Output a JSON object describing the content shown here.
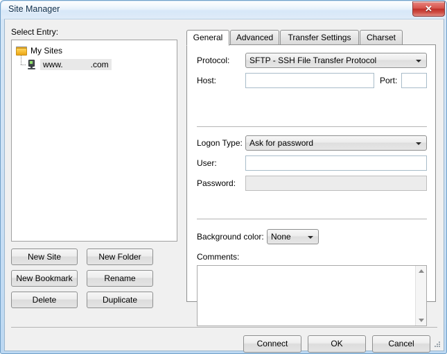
{
  "window": {
    "title": "Site Manager",
    "close_label": "✕",
    "close_icon": "close-icon"
  },
  "left_panel": {
    "select_entry_label": "Select Entry:",
    "tree": {
      "root": {
        "label": "My Sites",
        "icon": "folder-icon"
      },
      "children": [
        {
          "label": "www.            .com",
          "icon": "server-icon",
          "selected": true
        }
      ]
    },
    "buttons": [
      {
        "label": "New Site"
      },
      {
        "label": "New Folder"
      },
      {
        "label": "New Bookmark"
      },
      {
        "label": "Rename"
      },
      {
        "label": "Delete"
      },
      {
        "label": "Duplicate"
      }
    ]
  },
  "right_panel": {
    "tabs": [
      {
        "label": "General",
        "active": true
      },
      {
        "label": "Advanced",
        "active": false
      },
      {
        "label": "Transfer Settings",
        "active": false
      },
      {
        "label": "Charset",
        "active": false
      }
    ],
    "general": {
      "protocol_label": "Protocol:",
      "protocol_value": "SFTP - SSH File Transfer Protocol",
      "host_label": "Host:",
      "host_value": "",
      "port_label": "Port:",
      "port_value": "",
      "logon_type_label": "Logon Type:",
      "logon_type_value": "Ask for password",
      "user_label": "User:",
      "user_value": "",
      "password_label": "Password:",
      "password_value": "",
      "background_color_label": "Background color:",
      "background_color_value": "None",
      "comments_label": "Comments:",
      "comments_value": ""
    }
  },
  "footer": {
    "buttons": [
      {
        "label": "Connect"
      },
      {
        "label": "OK"
      },
      {
        "label": "Cancel"
      }
    ]
  },
  "colors": {
    "title_bar_start": "#e9f2fb",
    "title_bar_end": "#c6dcf3",
    "frame": "#bcd8f2",
    "dialog_background": "#f0f0f0",
    "panel_background": "#ffffff",
    "close_button": "#bf3029",
    "folder_icon": "#f6bc32",
    "selection_highlight": "#e8e8e8"
  }
}
